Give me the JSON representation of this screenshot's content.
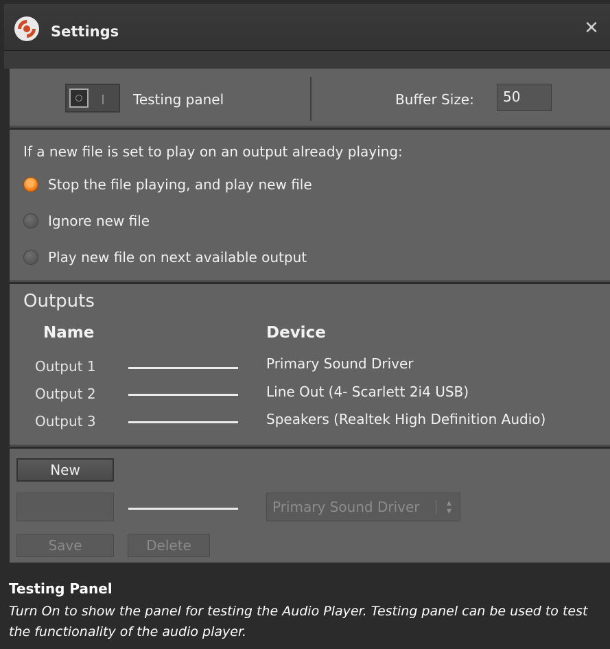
{
  "window": {
    "title": "Settings",
    "logo_icon": "app-logo-icon",
    "close_icon": "close-icon",
    "close_glyph": "✕"
  },
  "top_panel": {
    "testing_label": "Testing panel",
    "toggle_state": "off",
    "buffer_label": "Buffer Size:",
    "buffer_value": "50"
  },
  "playback": {
    "question": "If a new file is set to play on an output already playing:",
    "options": [
      {
        "label": "Stop the file playing, and play new file",
        "selected": true
      },
      {
        "label": "Ignore new file",
        "selected": false
      },
      {
        "label": "Play new file on next available output",
        "selected": false
      }
    ],
    "accent_color": "#f07c12"
  },
  "outputs": {
    "title": "Outputs",
    "name_header": "Name",
    "device_header": "Device",
    "rows": [
      {
        "name": "Output 1",
        "device": "Primary Sound Driver"
      },
      {
        "name": "Output 2",
        "device": "Line Out (4- Scarlett 2i4 USB)"
      },
      {
        "name": "Output 3",
        "device": "Speakers (Realtek High Definition Audio)"
      }
    ]
  },
  "editor": {
    "new_label": "New",
    "name_value": "",
    "device_select": "Primary Sound Driver",
    "save_label": "Save",
    "delete_label": "Delete"
  },
  "help": {
    "title": "Testing Panel",
    "text": "Turn On to show the panel for testing the Audio Player. Testing panel can be used to test the functionality of the audio player."
  }
}
